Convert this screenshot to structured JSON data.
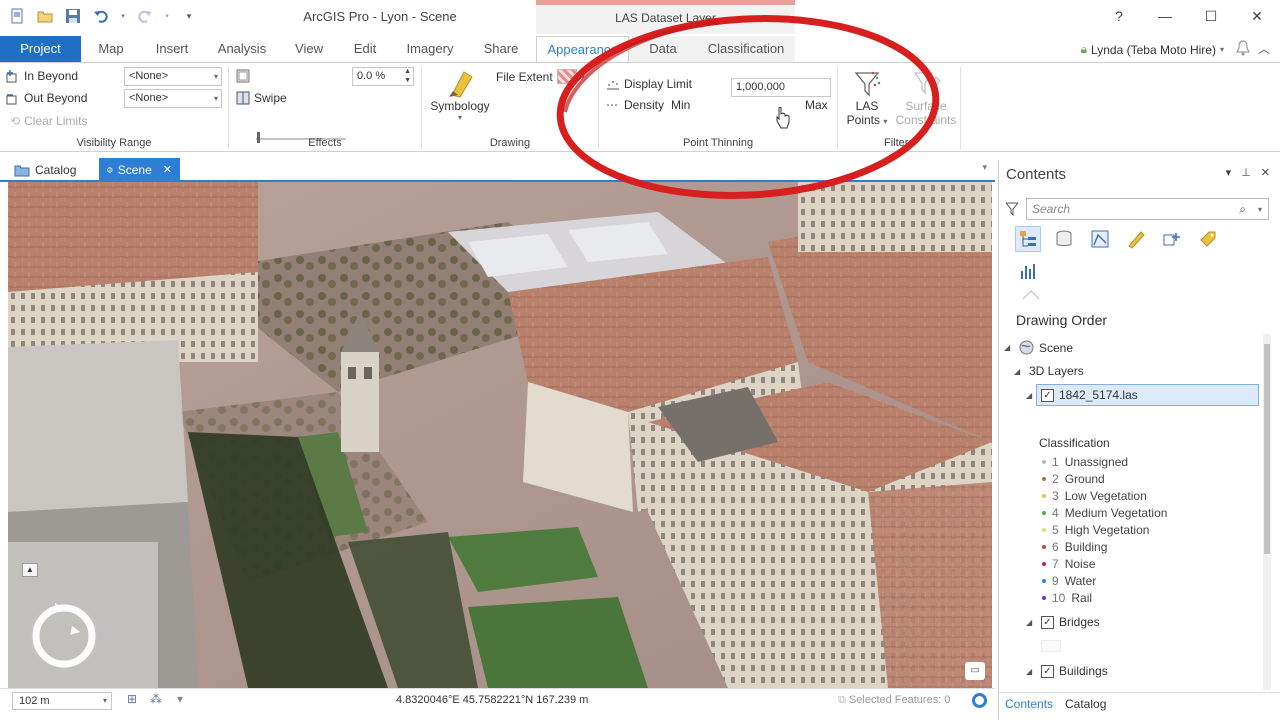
{
  "window": {
    "title": "ArcGIS Pro - Lyon - Scene",
    "context_title": "LAS Dataset Layer",
    "user": "Lynda (Teba Moto Hire)"
  },
  "quick_access": [
    "new-icon",
    "open-icon",
    "save-icon",
    "undo-icon",
    "redo-icon",
    "customize-icon"
  ],
  "tabs": {
    "project": "Project",
    "map": "Map",
    "insert": "Insert",
    "analysis": "Analysis",
    "view": "View",
    "edit": "Edit",
    "imagery": "Imagery",
    "share": "Share",
    "appearance": "Appearance",
    "data": "Data",
    "classification": "Classification"
  },
  "ribbon": {
    "visibility_range": {
      "in_beyond": "In Beyond",
      "out_beyond": "Out Beyond",
      "clear_limits": "Clear Limits",
      "in_value": "<None>",
      "out_value": "<None>",
      "label": "Visibility Range"
    },
    "effects": {
      "transparency": "0.0  %",
      "swipe": "Swipe",
      "label": "Effects"
    },
    "drawing": {
      "symbology": "Symbology",
      "file_extent": "File Extent",
      "label": "Drawing"
    },
    "point_thinning": {
      "display_limit": "Display Limit",
      "display_limit_value": "1,000,000",
      "density": "Density",
      "min": "Min",
      "max": "Max",
      "density_fraction": 0.75,
      "label": "Point Thinning"
    },
    "filters": {
      "las_points_line1": "LAS",
      "las_points_line2": "Points",
      "surface_line1": "Surface",
      "surface_line2": "Constraints",
      "label": "Filters"
    }
  },
  "view_tabs": {
    "catalog": "Catalog",
    "scene": "Scene"
  },
  "status": {
    "scale": "102 m",
    "coords": "4.8320046°E 45.7582221°N  167.239 m",
    "selected": "Selected Features: 0"
  },
  "contents": {
    "title": "Contents",
    "search_placeholder": "Search",
    "section": "Drawing Order",
    "scene": "Scene",
    "layers_3d": "3D Layers",
    "las_layer": "1842_5174.las",
    "classification_heading": "Classification",
    "classes": [
      {
        "num": "1",
        "name": "Unassigned",
        "color": "#b8b8b8"
      },
      {
        "num": "2",
        "name": "Ground",
        "color": "#b07a2a"
      },
      {
        "num": "3",
        "name": "Low Vegetation",
        "color": "#d9c83c"
      },
      {
        "num": "4",
        "name": "Medium Vegetation",
        "color": "#4caf3a"
      },
      {
        "num": "5",
        "name": "High Vegetation",
        "color": "#d6de7a"
      },
      {
        "num": "6",
        "name": "Building",
        "color": "#d0423a"
      },
      {
        "num": "7",
        "name": "Noise",
        "color": "#c21a5a"
      },
      {
        "num": "9",
        "name": "Water",
        "color": "#3a7fd6"
      },
      {
        "num": "10",
        "name": "Rail",
        "color": "#7a2fbf"
      }
    ],
    "bridges": "Bridges",
    "buildings": "Buildings",
    "tab_contents": "Contents",
    "tab_catalog": "Catalog"
  },
  "colors": {
    "accent": "#2d7fd3",
    "project_tab": "#1f6fc4",
    "annotation": "#d81f1f"
  }
}
